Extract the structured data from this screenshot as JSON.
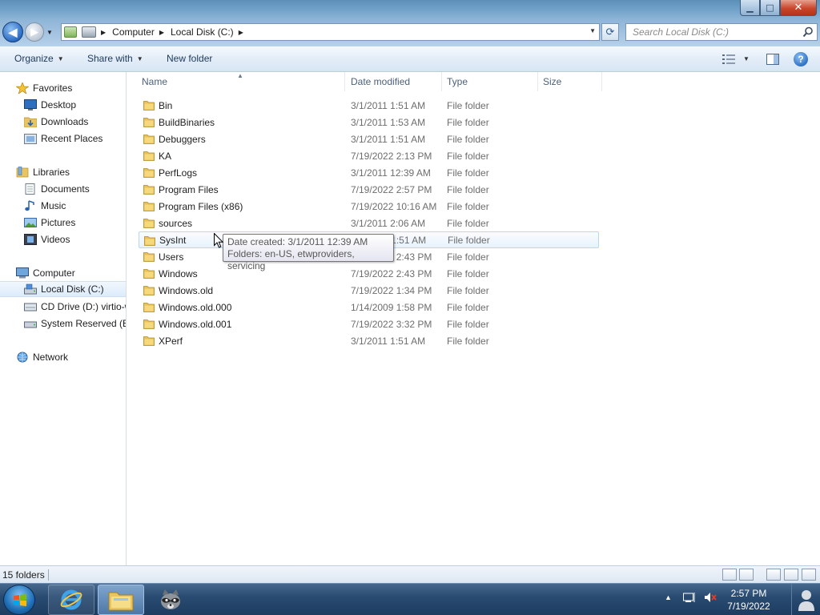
{
  "window": {
    "caption_buttons": {
      "minimize": "▁",
      "maximize": "□",
      "close": "✕"
    }
  },
  "nav": {
    "back_glyph": "◀",
    "forward_glyph": "▶",
    "breadcrumb": [
      "Computer",
      "Local Disk (C:)"
    ],
    "search_placeholder": "Search Local Disk (C:)"
  },
  "toolbar": {
    "organize": "Organize",
    "share_with": "Share with",
    "new_folder": "New folder",
    "help": "?"
  },
  "sidebar": {
    "favorites": {
      "label": "Favorites",
      "items": [
        "Desktop",
        "Downloads",
        "Recent Places"
      ]
    },
    "libraries": {
      "label": "Libraries",
      "items": [
        "Documents",
        "Music",
        "Pictures",
        "Videos"
      ]
    },
    "computer": {
      "label": "Computer",
      "items": [
        "Local Disk (C:)",
        "CD Drive (D:) virtio-w",
        "System Reserved (E:)"
      ],
      "selected": "Local Disk (C:)"
    },
    "network": {
      "label": "Network"
    }
  },
  "columns": {
    "name": "Name",
    "date": "Date modified",
    "type": "Type",
    "size": "Size"
  },
  "files": [
    {
      "name": "Bin",
      "date": "3/1/2011 1:51 AM",
      "type": "File folder"
    },
    {
      "name": "BuildBinaries",
      "date": "3/1/2011 1:53 AM",
      "type": "File folder"
    },
    {
      "name": "Debuggers",
      "date": "3/1/2011 1:51 AM",
      "type": "File folder"
    },
    {
      "name": "KA",
      "date": "7/19/2022 2:13 PM",
      "type": "File folder"
    },
    {
      "name": "PerfLogs",
      "date": "3/1/2011 12:39 AM",
      "type": "File folder"
    },
    {
      "name": "Program Files",
      "date": "7/19/2022 2:57 PM",
      "type": "File folder"
    },
    {
      "name": "Program Files (x86)",
      "date": "7/19/2022 10:16 AM",
      "type": "File folder"
    },
    {
      "name": "sources",
      "date": "3/1/2011 2:06 AM",
      "type": "File folder"
    },
    {
      "name": "SysInt",
      "date": "3/1/2011 1:51 AM",
      "type": "File folder"
    },
    {
      "name": "Users",
      "date": "7/19/2022 2:43 PM",
      "type": "File folder"
    },
    {
      "name": "Windows",
      "date": "7/19/2022 2:43 PM",
      "type": "File folder"
    },
    {
      "name": "Windows.old",
      "date": "7/19/2022 1:34 PM",
      "type": "File folder"
    },
    {
      "name": "Windows.old.000",
      "date": "1/14/2009 1:58 PM",
      "type": "File folder"
    },
    {
      "name": "Windows.old.001",
      "date": "7/19/2022 3:32 PM",
      "type": "File folder"
    },
    {
      "name": "XPerf",
      "date": "3/1/2011 1:51 AM",
      "type": "File folder"
    }
  ],
  "hovered_file": "SysInt",
  "tooltip": {
    "line1": "Date created: 3/1/2011 12:39 AM",
    "line2": "Folders: en-US, etwproviders, servicing"
  },
  "status": {
    "count": "15 folders"
  },
  "taskbar": {
    "clock_time": "2:57 PM",
    "clock_date": "7/19/2022",
    "items": [
      "internet-explorer-icon",
      "windows-explorer-icon",
      "raccoon-app-icon"
    ]
  },
  "colors": {
    "title_blue": "#6c9ec6",
    "selection_border": "#b8d6fb",
    "taskbar": "#2a4c72"
  }
}
